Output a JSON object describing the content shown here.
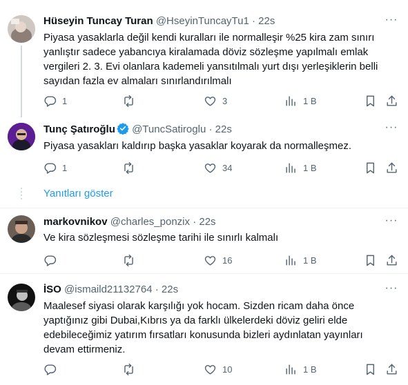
{
  "tweets": [
    {
      "name": "Hüseyin Tuncay Turan",
      "handle": "@HseyinTuncayTu1",
      "dot": "·",
      "time": "22s",
      "text": "Piyasa yasaklarla değil kendi kuralları ile normalleşir %25 kira zam sınırı yanlıştır sadece yabancıya kiralamada döviz sözleşme yapılmalı emlak vergileri 2. 3. Evi olanlara kademeli yansıtılmalı yurt dışı yerleşiklerin belli sayıdan fazla ev almaları sınırlandırılmalı",
      "replies": "1",
      "retweets": "",
      "likes": "3",
      "views": "1 B"
    },
    {
      "name": "Tunç Şatıroğlu",
      "handle": "@TuncSatiroglu",
      "dot": "·",
      "time": "22s",
      "text": "Piyasa yasakları kaldırıp başka yasaklar koyarak da normalleşmez.",
      "replies": "1",
      "retweets": "",
      "likes": "34",
      "views": "1 B"
    },
    {
      "name": "markovnikov",
      "handle": "@charles_ponzix",
      "dot": "·",
      "time": "22s",
      "text": "Ve kira sözleşmesi sözleşme tarihi ile sınırlı kalmalı",
      "replies": "",
      "retweets": "",
      "likes": "16",
      "views": "1 B"
    },
    {
      "name": "İSO",
      "handle": "@ismaild21132764",
      "dot": "·",
      "time": "22s",
      "text": "Maalesef siyasi olarak karşılığı yok hocam. Sizden ricam daha önce yaptığınız gibi Dubai,Kıbrıs ya da farklı ülkelerdeki döviz geliri elde edebileceğimiz yatırım fırsatları konusunda bizleri aydınlatan yayınları devam ettirmeniz.",
      "replies": "",
      "retweets": "",
      "likes": "10",
      "views": "1 B"
    }
  ],
  "show_replies": "Yanıtları göster",
  "more_glyph": "···",
  "colors": {
    "accent": "#1d9bf0",
    "muted": "#536471",
    "verified": "#1d9bf0"
  },
  "icons": [
    "reply-icon",
    "retweet-icon",
    "like-icon",
    "views-icon",
    "bookmark-icon",
    "share-icon",
    "more-icon",
    "verified-badge-icon"
  ]
}
